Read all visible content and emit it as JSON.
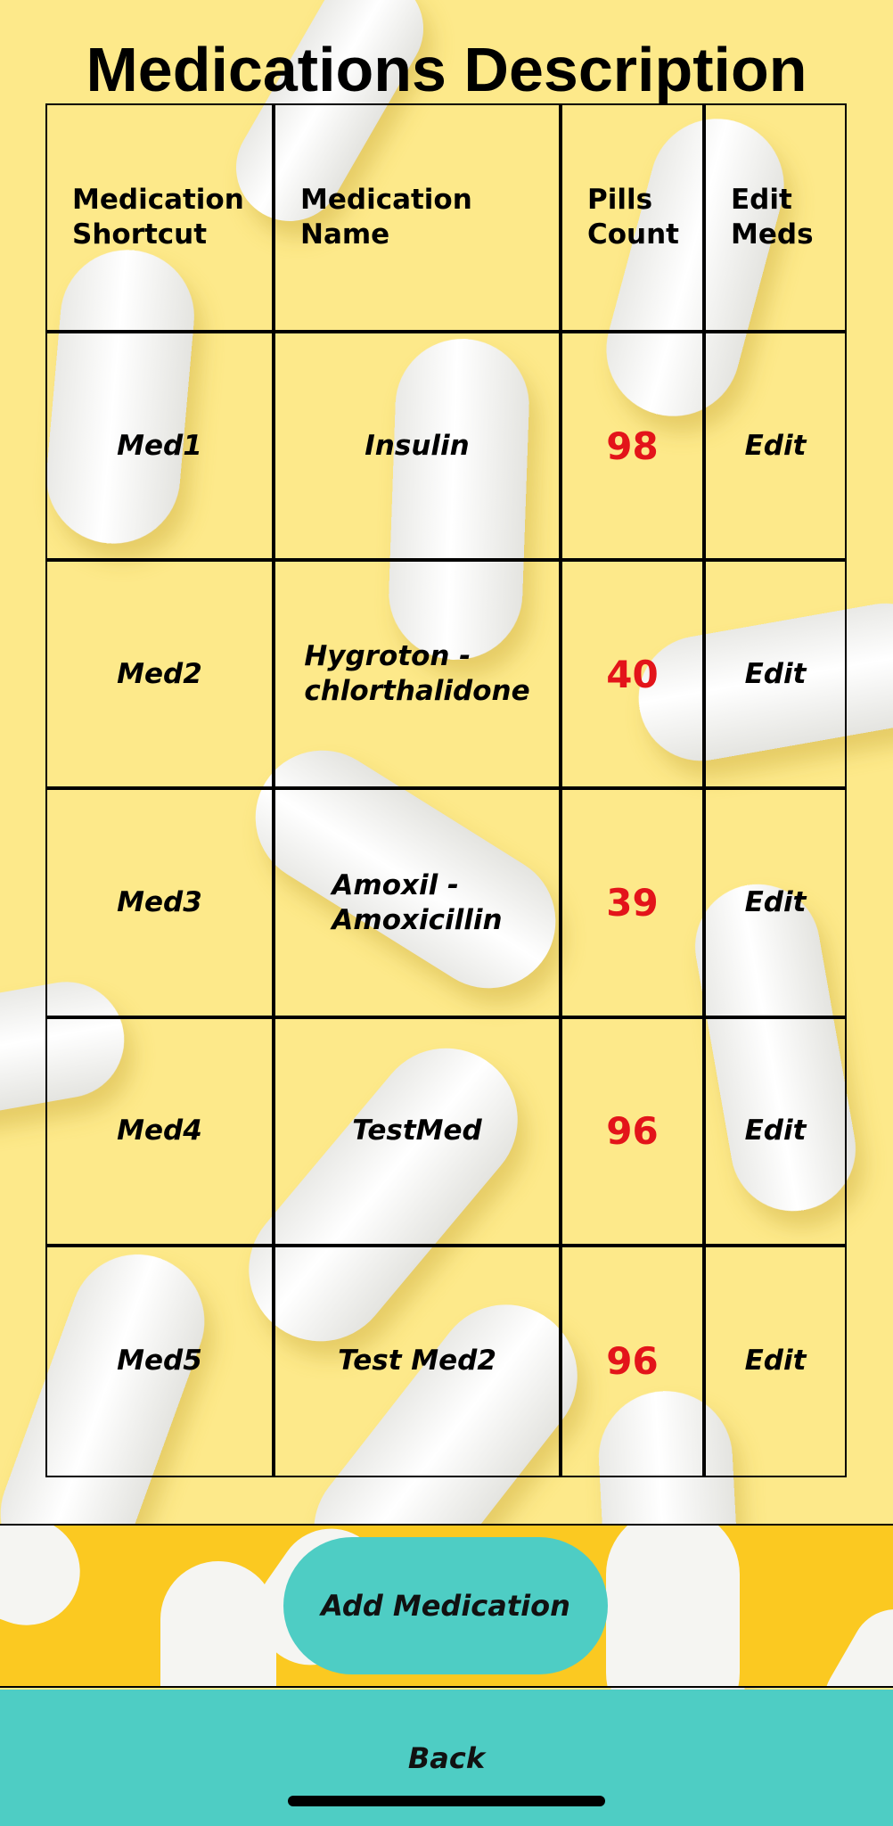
{
  "header": {
    "title": "Medications Description"
  },
  "table": {
    "headers": [
      "Medication\nShortcut",
      "Medication\nName",
      "Pills\nCount",
      "Edit\nMeds"
    ],
    "rows": [
      {
        "shortcut": "Med1",
        "name": "Insulin",
        "count": "98",
        "edit": "Edit"
      },
      {
        "shortcut": "Med2",
        "name": "Hygroton -\nchlorthalidone",
        "count": "40",
        "edit": "Edit"
      },
      {
        "shortcut": "Med3",
        "name": "Amoxil  -\nAmoxicillin",
        "count": "39",
        "edit": "Edit"
      },
      {
        "shortcut": "Med4",
        "name": "TestMed",
        "count": "96",
        "edit": "Edit"
      },
      {
        "shortcut": "Med5",
        "name": "Test Med2",
        "count": "96",
        "edit": "Edit"
      }
    ]
  },
  "actions": {
    "add_label": "Add Medication",
    "back_label": "Back"
  },
  "colors": {
    "background": "#fde98a",
    "add_band": "#fbc921",
    "button_teal": "#4ecdc4",
    "count_red": "#e3141a"
  },
  "background_image": {
    "icon": "white-capsule-pills-icon"
  }
}
